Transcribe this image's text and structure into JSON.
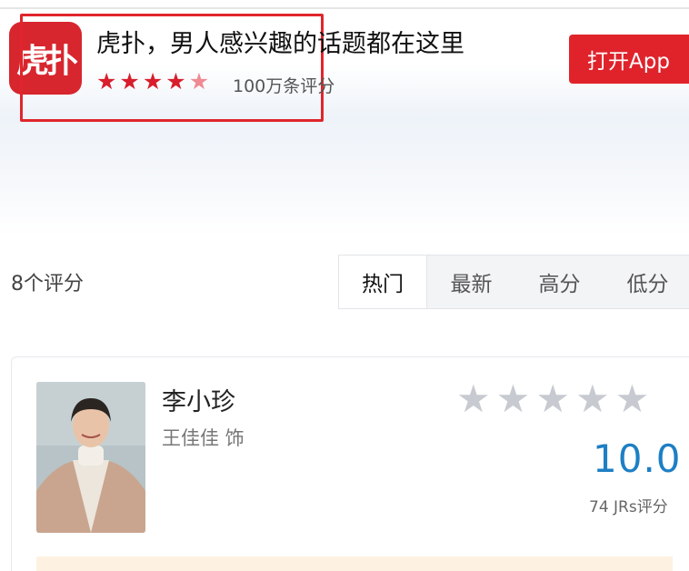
{
  "app": {
    "icon_text": "虎扑",
    "title": "虎扑，男人感兴趣的话题都在这里",
    "rating_count": "100万条评分",
    "open_button": "打开App",
    "stars": 4.5
  },
  "filter": {
    "total": "8个评分",
    "tabs": [
      "热门",
      "最新",
      "高分",
      "低分"
    ],
    "active_tab": "热门"
  },
  "character": {
    "name": "李小珍",
    "actor": "王佳佳 饰",
    "score": "10.0",
    "score_count": "74 JRs评分",
    "stars": 0
  },
  "colors": {
    "brand_red": "#e0232b",
    "score_blue": "#1d7fc4",
    "star_gray": "#c7cbd1"
  }
}
